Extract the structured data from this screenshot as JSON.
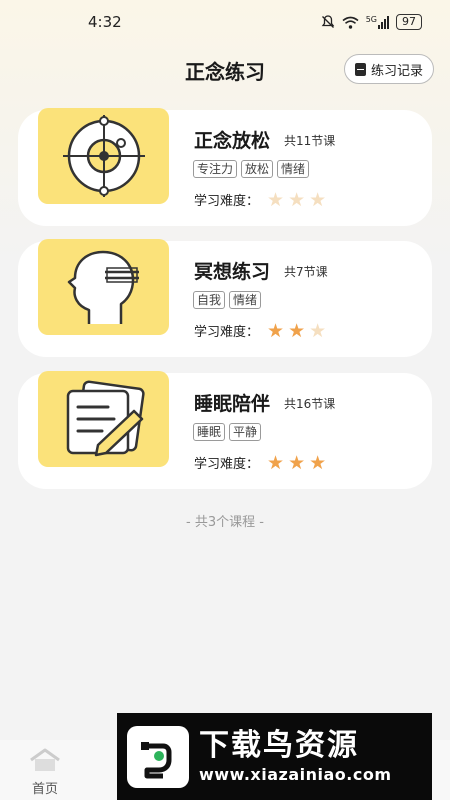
{
  "status_bar": {
    "time": "4:32",
    "signal_label": "5G",
    "battery": "97",
    "icons": [
      "mute-icon",
      "wifi-icon",
      "signal-icon",
      "battery-icon"
    ]
  },
  "header": {
    "title": "正念练习",
    "record_button": "练习记录",
    "record_icon": "notebook-icon"
  },
  "courses": [
    {
      "name": "正念放松",
      "lessons": "共11节课",
      "tags": [
        "专注力",
        "放松",
        "情绪"
      ],
      "difficulty_label": "学习难度：",
      "difficulty_level": 0,
      "max_stars": 3,
      "thumb_icon": "orbit-target-icon"
    },
    {
      "name": "冥想练习",
      "lessons": "共7节课",
      "tags": [
        "自我",
        "情绪"
      ],
      "difficulty_label": "学习难度：",
      "difficulty_level": 2,
      "max_stars": 3,
      "thumb_icon": "head-meditation-icon"
    },
    {
      "name": "睡眠陪伴",
      "lessons": "共16节课",
      "tags": [
        "睡眠",
        "平静"
      ],
      "difficulty_label": "学习难度：",
      "difficulty_level": 3,
      "max_stars": 3,
      "thumb_icon": "notepad-pencil-icon"
    }
  ],
  "footer_note": "- 共3个课程 -",
  "bottom_nav": {
    "home_label": "首页",
    "home_icon": "home-icon"
  },
  "watermark": {
    "title": "下载鸟资源",
    "url": "www.xiazainiao.com"
  },
  "colors": {
    "thumb_bg": "#fbe27a",
    "star_on": "#f0a24b",
    "star_off": "#f5dfc0",
    "page_bg": "#f3f3f3"
  }
}
